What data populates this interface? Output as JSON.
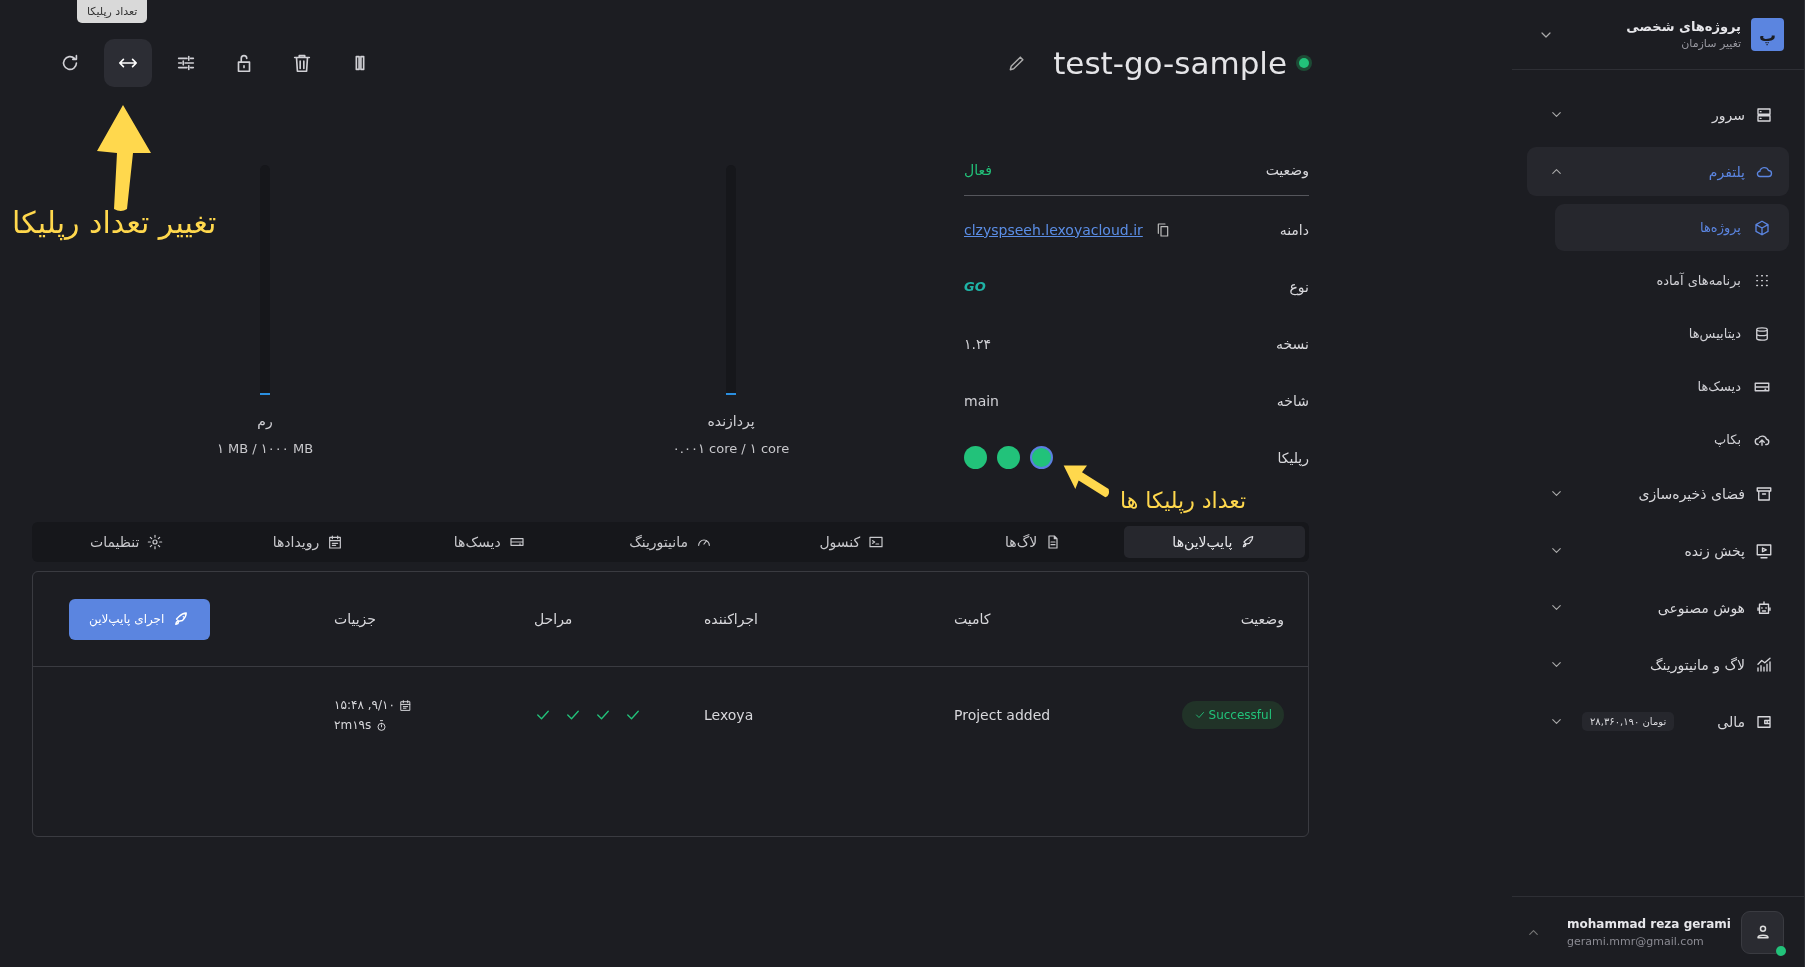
{
  "tooltip": "تعداد رپلیکا",
  "toolbar": [
    {
      "hovered": false
    },
    {
      "hovered": true
    },
    {
      "hovered": false
    },
    {
      "hovered": false
    },
    {
      "hovered": false
    },
    {
      "hovered": false
    }
  ],
  "annotations": [
    {
      "text": "تغییر تعداد رپلیکا"
    },
    {
      "text": "تعداد رپلیکا ها"
    }
  ],
  "project": {
    "title": "test-go-sample",
    "online": true
  },
  "meters": [
    {
      "label": "پردازنده",
      "reading": "۰.۰۰۱ core / ۱ core",
      "level": 0.001
    },
    {
      "label": "رم",
      "reading": "۱ MB / ۱۰۰۰ MB",
      "level": 0.001
    }
  ],
  "info": [
    {
      "kind": "status",
      "label": "وضعیت",
      "value": "فعال"
    },
    {
      "kind": "link",
      "label": "دامنه",
      "value": "clzyspseeh.lexoyacloud.ir"
    },
    {
      "kind": "logo",
      "label": "نوع",
      "value": "GO"
    },
    {
      "kind": "text",
      "label": "نسخه",
      "value": "۱.۲۴"
    },
    {
      "kind": "text",
      "label": "شاخه",
      "value": "main"
    },
    {
      "kind": "replicas",
      "label": "رپلیکا",
      "replicas": [
        {
          "selected": false
        },
        {
          "selected": false
        },
        {
          "selected": true
        }
      ]
    }
  ],
  "tabs": [
    {
      "label": "پایپ‌لاین‌ها",
      "selected": true
    },
    {
      "label": "لاگ‌ها",
      "selected": false
    },
    {
      "label": "کنسول",
      "selected": false
    },
    {
      "label": "مانیتورینگ",
      "selected": false
    },
    {
      "label": "دیسک‌ها",
      "selected": false
    },
    {
      "label": "رویدادها",
      "selected": false
    },
    {
      "label": "تنظیمات",
      "selected": false
    }
  ],
  "pipeline": {
    "columns": [
      "وضعیت",
      "کامیت",
      "اجراکننده",
      "مراحل",
      "جزییات"
    ],
    "action": "اجرای پایپ‌لاین",
    "rows": [
      {
        "status": "Successful",
        "kind": "success",
        "commit": "Project added",
        "runner": "Lexoya",
        "steps": [
          {
            "done": true
          },
          {
            "done": true
          },
          {
            "done": true
          },
          {
            "done": true
          }
        ],
        "date": "۹/۱۰, ۱۵:۴۸",
        "duration": "۲m۱۹s"
      }
    ]
  },
  "sidebar": {
    "org": {
      "avatar": "پ",
      "name": "پروژه‌های شخصی",
      "subtitle": "تغییر سازمان"
    },
    "items": [
      {
        "label": "سرور",
        "selected": false,
        "expanded": false
      },
      {
        "label": "پلتفرم",
        "selected": true,
        "expanded": true,
        "children": [
          {
            "label": "پروژه‌ها",
            "selected": true
          },
          {
            "label": "برنامه‌های آماده",
            "selected": false
          },
          {
            "label": "دیتابیس‌ها",
            "selected": false
          },
          {
            "label": "دیسک‌ها",
            "selected": false
          },
          {
            "label": "بکاپ",
            "selected": false
          }
        ]
      },
      {
        "label": "فضای ذخیره‌سازی",
        "selected": false,
        "expanded": false
      },
      {
        "label": "پخش زنده",
        "selected": false,
        "expanded": false
      },
      {
        "label": "هوش مصنوعی",
        "selected": false,
        "expanded": false
      },
      {
        "label": "لاگ و مانیتورینگ",
        "selected": false,
        "expanded": false
      },
      {
        "label": "مالی",
        "selected": false,
        "expanded": false,
        "badge": "تومان ۲۸,۳۶۰,۱۹۰"
      }
    ],
    "user": {
      "name": "mohammad reza gerami",
      "email": "gerami.mmr@gmail.com",
      "online": true
    }
  }
}
